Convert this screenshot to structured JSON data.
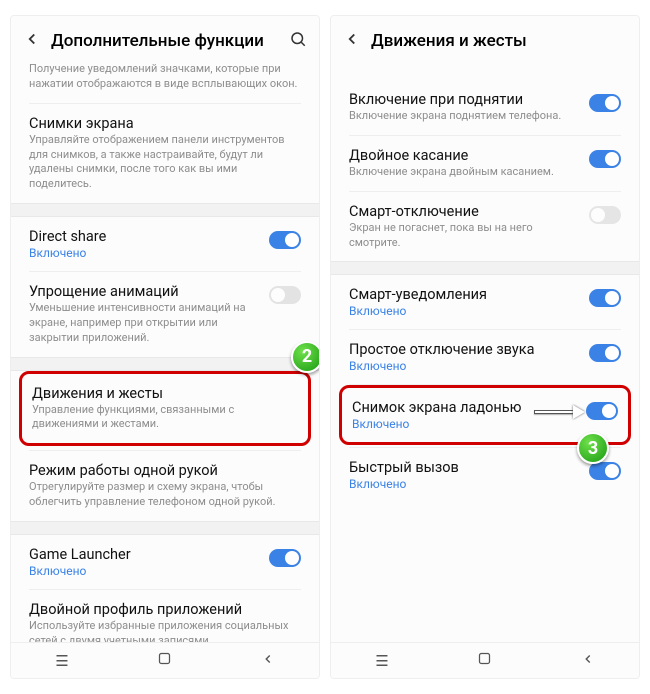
{
  "left": {
    "header": {
      "title": "Дополнительные функции"
    },
    "intro_desc": "Получение уведомлений значками, которые при нажатии отображаются в виде всплывающих окон.",
    "screenshots": {
      "title": "Снимки экрана",
      "desc": "Управляйте отображением панели инструментов для снимков, а также настраивайте, будут ли удалены снимки, после того как вы ими поделитесь."
    },
    "direct_share": {
      "title": "Direct share",
      "status": "Включено"
    },
    "reduce_anim": {
      "title": "Упрощение анимаций",
      "desc": "Уменьшение интенсивности анимаций на экране, например при открытии или закрытии приложений."
    },
    "motions": {
      "title": "Движения и жесты",
      "desc": "Управление функциями, связанными с движениями и жестами."
    },
    "one_hand": {
      "title": "Режим работы одной рукой",
      "desc": "Отрегулируйте размер и схему экрана, чтобы облегчить управление телефоном одной рукой."
    },
    "game_launcher": {
      "title": "Game Launcher",
      "status": "Включено"
    },
    "dual_messenger": {
      "title": "Двойной профиль приложений",
      "desc": "Используйте избранные приложения социальных сетей с двумя учетными записями."
    }
  },
  "right": {
    "header": {
      "title": "Движения и жесты"
    },
    "lift_wake": {
      "title": "Включение при поднятии",
      "desc": "Включение экрана поднятием телефона."
    },
    "double_tap": {
      "title": "Двойное касание",
      "desc": "Включение экрана двойным касанием."
    },
    "smart_stay": {
      "title": "Смарт-отключение",
      "desc": "Экран не погаснет, пока вы на него смотрите."
    },
    "smart_alert": {
      "title": "Смарт-уведомления",
      "status": "Включено"
    },
    "easy_mute": {
      "title": "Простое отключение звука",
      "status": "Включено"
    },
    "palm_swipe": {
      "title": "Снимок экрана ладонью",
      "status": "Включено"
    },
    "direct_call": {
      "title": "Быстрый вызов",
      "status": "Включено"
    }
  },
  "markers": {
    "two": "2",
    "three": "3"
  }
}
